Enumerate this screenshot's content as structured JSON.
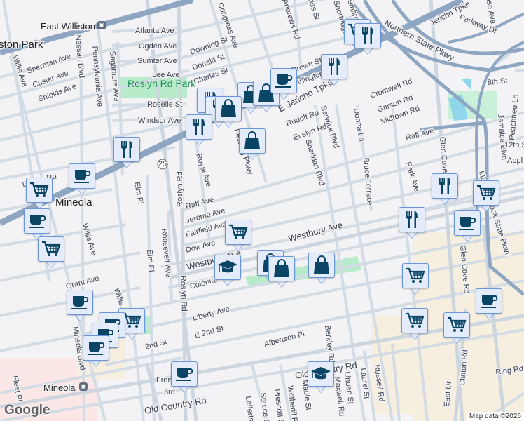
{
  "map": {
    "places": {
      "east_williston": "East Williston",
      "williston_park": "ston Park",
      "mineola": "Mineola",
      "mineola_station": "Mineola",
      "park": "Roslyn Rd Park",
      "park2": "Rd Park",
      "route": "25"
    },
    "streets": {
      "atlanta": "Atlanta Ave",
      "ogden": "Ogden Ave",
      "sumter": "Sumter Ave",
      "lee": "Lee Ave",
      "downing": "Downing St",
      "donald": "Donald St",
      "charles": "Charles St",
      "congress": "Congress Ave",
      "sherman": "Sherman Ave",
      "custer": "Custer Ave",
      "shields": "Shields Ave",
      "willis1": "Willis Ave",
      "nassau": "Nassau Blvd",
      "penn": "Pennsylvania Ave",
      "sagamore": "Sagamore Ave",
      "roselle": "Roselle St",
      "windsor": "Windsor Ave",
      "linden": "Linden Rd",
      "elm": "Elm Pl",
      "roslyn": "Roslyn Rd",
      "royal": "Royal Ave",
      "raff1": "Raff Ave",
      "jerome": "Jerome Ave",
      "fairfield": "Fairfield Ave",
      "dow": "Dow Ave",
      "westbury1": "Westbury Ave",
      "westbury2": "Westbury Ave",
      "colonial": "Colonial",
      "grant": "Grant Ave",
      "willis2": "Willis Ave",
      "roosevelt": "Roosevelt Ave",
      "elm2": "Elm Pl",
      "roslyn2": "Roslyn Rd",
      "liberty": "Liberty Ave",
      "e2nd": "E 2nd St",
      "second": "2nd St",
      "mineola_blvd": "Mineola Blvd",
      "front": "Front",
      "third": "3rd",
      "old_country": "Old Country Rd",
      "old_country2": "Old Country Rd",
      "albertson": "Albertson Pl",
      "berkley": "Berkley Rd",
      "maxwell": "Maxwell Rd",
      "linden_st": "Linden St",
      "laurel": "Laurel St",
      "russell": "Russell Rd",
      "maple": "Maple St",
      "wetherill": "Wetherill Rd",
      "prescott": "Prescott St",
      "spruce": "Spruce St",
      "lefferts": "Lefferts",
      "fleet": "Fleet Pl",
      "east_dr": "East Dr",
      "clinton": "Clinton Rd",
      "ring": "Ring Rd",
      "glen_cove": "Glen Cove Rd",
      "glen_cove2": "Glen Cove Rd",
      "jericho": "E Jericho Tpke",
      "jericho2": "Jericho Tpke",
      "northern": "Northern State Pkwy",
      "parkway_dr": "Parkway Dr",
      "meadowbrook": "Meadowbrook State Pkwy",
      "jamaica": "Jamaica Blvd",
      "cromwell": "Cromwell Rd",
      "garson": "Garson Rd",
      "midtown": "Midtown Rd",
      "raff2": "Raff Ave",
      "rudolf": "Rudolf Rd",
      "evelyn": "Evelyn Rd",
      "barwick": "Barwick Blvd",
      "sheridan": "Sheridan Blvd",
      "donna": "Donna Ln",
      "bruce": "Bruce Terrace",
      "park_ave": "Park Ave",
      "brown": "Brown St",
      "arlington": "Arlington",
      "shortridge": "Shortridge Dr",
      "andrews": "Andrews Rd",
      "charles2": "Charles St",
      "pembroke": "Pembro",
      "eighth": "8th St",
      "twelfth": "12th St",
      "peachtree": "Peachtree Ln",
      "apple": "Appl",
      "ro": "Ro",
      "ne_ave": "ose Ave",
      "mineola_blvd_top": "Ro",
      "fieldingpkwy": "Fielding Pkwy"
    },
    "markers": [
      "cart",
      "fork",
      "fork",
      "bag",
      "bag",
      "cup",
      "fork",
      "fork",
      "bag",
      "fork",
      "bag",
      "fork",
      "cup",
      "cart",
      "cup",
      "cart",
      "fork",
      "cart",
      "fork",
      "cup",
      "cart",
      "grad",
      "bag",
      "bag",
      "bag",
      "cart",
      "cart",
      "cart",
      "cup",
      "cup",
      "cart",
      "cup",
      "cup",
      "cup",
      "cup",
      "grad"
    ],
    "attribution": "Map data ©2026",
    "logo": "Google"
  },
  "colors": {
    "bg": "#f3f2f4",
    "road": "#d3dce5",
    "highway": "#8ea6c1",
    "park": "#b7ebc9",
    "commercial": "#f6efdf",
    "icon": "#0b4566"
  }
}
